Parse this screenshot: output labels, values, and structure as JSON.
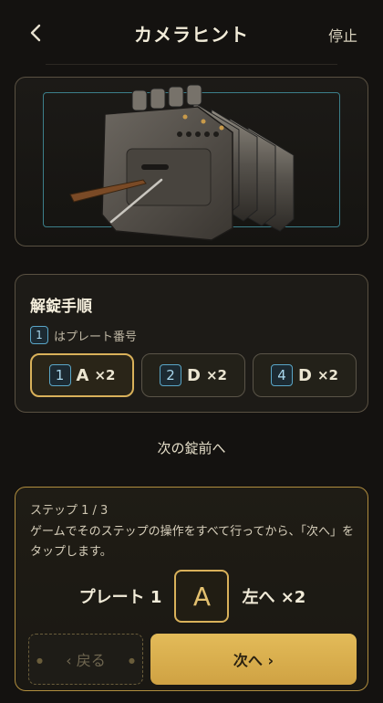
{
  "header": {
    "back_icon": "chevron-left-icon",
    "title": "カメラヒント",
    "stop_label": "停止"
  },
  "camera": {
    "subject": "lock-mechanism-image"
  },
  "procedure": {
    "title": "解錠手順",
    "hint_number": "1",
    "hint_text": "はプレート番号",
    "steps": [
      {
        "plate": "1",
        "letter": "A",
        "count": "×2",
        "active": true
      },
      {
        "plate": "2",
        "letter": "D",
        "count": "×2",
        "active": false
      },
      {
        "plate": "4",
        "letter": "D",
        "count": "×2",
        "active": false
      }
    ]
  },
  "next_lock_label": "次の錠前へ",
  "step_panel": {
    "label": "ステップ 1 / 3",
    "description": "ゲームでそのステップの操作をすべて行ってから、「次へ」をタップします。",
    "plate_label": "プレート 1",
    "letter": "A",
    "direction_label": "左へ ×2",
    "back_label": "‹ 戻る",
    "next_label": "次へ ›"
  },
  "colors": {
    "accent": "#d9b15a",
    "plate_number": "#5aa6c7",
    "background": "#141210"
  }
}
